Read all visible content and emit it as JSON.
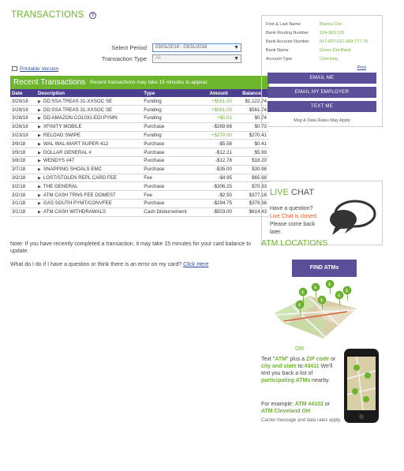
{
  "page": {
    "title": "TRANSACTIONS",
    "help_icon": "question-circle-icon"
  },
  "filters": {
    "period_label": "Select Period",
    "period_value": "03/01/2018 - 03/31/2018",
    "type_label": "Transaction Type",
    "type_value": "All"
  },
  "printable": "Printable Version",
  "transactions": {
    "heading": "Recent Transactions",
    "note": "Recent transactions may take 15 minutes to appear.",
    "columns": [
      "Date",
      "Description",
      "Type",
      "Amount",
      "Balance"
    ],
    "rows": [
      {
        "date": "3/29/18",
        "desc": "DD:SSA TREAS 31-XXSOC SE",
        "type": "Funding",
        "amount": "+$561.00",
        "balance": "$1,122.74",
        "positive": true
      },
      {
        "date": "3/29/18",
        "desc": "DD:SSA TREAS 31-XXSOC SE",
        "type": "Funding",
        "amount": "+$561.00",
        "balance": "$561.74",
        "positive": true
      },
      {
        "date": "3/28/18",
        "desc": "DD:AMAZON.CO1031-EDI PYMN",
        "type": "Funding",
        "amount": "+$0.01",
        "balance": "$0.74",
        "positive": true
      },
      {
        "date": "3/26/18",
        "desc": "XFINITY MOBILE",
        "type": "Purchase",
        "amount": "-$269.68",
        "balance": "$0.73",
        "positive": false
      },
      {
        "date": "3/23/18",
        "desc": "RELOAD SWIPE",
        "type": "Funding",
        "amount": "+$270.00",
        "balance": "$270.41",
        "positive": true
      },
      {
        "date": "3/9/18",
        "desc": "WAL WAL-MART SUPER 412",
        "type": "Purchase",
        "amount": "-$5.58",
        "balance": "$0.41",
        "positive": false
      },
      {
        "date": "3/9/18",
        "desc": "DOLLAR GENERAL #",
        "type": "Purchase",
        "amount": "-$12.21",
        "balance": "$5.99",
        "positive": false
      },
      {
        "date": "3/8/18",
        "desc": "WENDYS #47",
        "type": "Purchase",
        "amount": "-$12.78",
        "balance": "$18.20",
        "positive": false
      },
      {
        "date": "3/7/18",
        "desc": "SNAPPING SHOALS EMC",
        "type": "Purchase",
        "amount": "-$35.00",
        "balance": "$30.98",
        "positive": false
      },
      {
        "date": "3/2/18",
        "desc": "LOST/STOLEN REPL CARD FEE",
        "type": "Fee",
        "amount": "-$4.95",
        "balance": "$65.98",
        "positive": false
      },
      {
        "date": "3/2/18",
        "desc": "THE GENERAL",
        "type": "Purchase",
        "amount": "-$306.25",
        "balance": "$70.93",
        "positive": false
      },
      {
        "date": "3/2/18",
        "desc": "ATM CASH TRNS FEE DOMEST",
        "type": "Fee",
        "amount": "-$2.50",
        "balance": "$377.18",
        "positive": false
      },
      {
        "date": "3/1/18",
        "desc": "GAS SOUTH PYMT/CONVFEE",
        "type": "Purchase",
        "amount": "-$294.75",
        "balance": "$379.68",
        "positive": false
      },
      {
        "date": "3/1/18",
        "desc": "ATM CASH WITHDRAWALS",
        "type": "Cash Disbursement",
        "amount": "-$503.00",
        "balance": "$614.43",
        "positive": false
      }
    ]
  },
  "notes": {
    "pending": "Note: If you have recently completed a transaction, it may take 15 minutes for your card balance to update.",
    "question": "What do I do if I have a question or think there is an error on my card?",
    "click_here": "Click Here"
  },
  "account": {
    "fields": [
      {
        "label": "First & Last Name",
        "value": "Bianca Cox"
      },
      {
        "label": "Bank Routing Number",
        "value": "124-303-120"
      },
      {
        "label": "Bank Account Number",
        "value": "017-027-012-369-777-76"
      },
      {
        "label": "Bank Name",
        "value": "Green Dot Bank"
      },
      {
        "label": "Account Type",
        "value": "Checking"
      }
    ],
    "print": "Print",
    "buttons": {
      "email_me": "EMAIL ME",
      "email_employer": "EMAIL MY EMPLOYER",
      "text_me": "TEXT ME"
    },
    "rates": "Msg & Data Rates May Apply"
  },
  "chat": {
    "title_live": "LIVE",
    "title_chat": " CHAT",
    "line1": "Have a question?",
    "closed_text": "Live Chat is closed.",
    "line3": "Please come back later."
  },
  "atm": {
    "title": "ATM LOCATIONS",
    "find": "FIND ATMs",
    "or": "OR",
    "sms_1": "Text \"",
    "sms_atm": "ATM",
    "sms_2": "\" plus a ",
    "sms_zip": "ZIP code",
    "sms_3": " or ",
    "sms_city": "city and state",
    "sms_4": " to:",
    "sms_num": "43411",
    "sms_5": " We'll text you back a list of ",
    "sms_part": "participating ATMs",
    "sms_6": " nearby.",
    "ex_1": "For example: ",
    "ex_a": "ATM 44102",
    "ex_2": " or ",
    "ex_b": "ATM Cleveland OH",
    "carrier": "Carrier message and data rates apply",
    "colors": {
      "accent": "#6cb52d",
      "brand": "#5a4f98"
    }
  }
}
